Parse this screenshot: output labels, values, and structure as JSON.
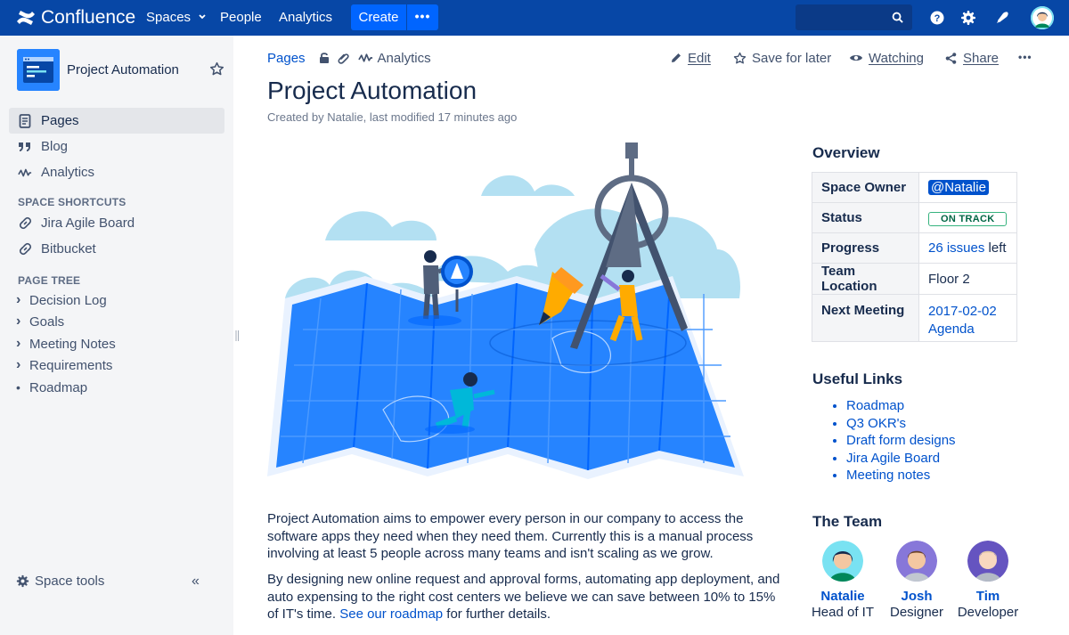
{
  "topnav": {
    "logo_text": "Confluence",
    "spaces_label": "Spaces",
    "people_label": "People",
    "analytics_label": "Analytics",
    "create_label": "Create",
    "more_label": "•••",
    "search_placeholder": "",
    "icons": [
      "search-icon",
      "help-icon",
      "settings-icon",
      "notifications-icon",
      "user-avatar"
    ]
  },
  "sidebar": {
    "space_name": "Project Automation",
    "nav": [
      {
        "label": "Pages",
        "icon": "pages-icon",
        "active": true
      },
      {
        "label": "Blog",
        "icon": "quote-icon"
      },
      {
        "label": "Analytics",
        "icon": "analytics-icon"
      }
    ],
    "shortcuts_heading": "SPACE SHORTCUTS",
    "shortcuts": [
      {
        "label": "Jira Agile Board",
        "icon": "link-icon"
      },
      {
        "label": "Bitbucket",
        "icon": "link-icon"
      }
    ],
    "tree_heading": "PAGE TREE",
    "tree": [
      {
        "label": "Decision Log",
        "marker": "›"
      },
      {
        "label": "Goals",
        "marker": "›"
      },
      {
        "label": "Meeting Notes",
        "marker": "›"
      },
      {
        "label": "Requirements",
        "marker": "›"
      },
      {
        "label": "Roadmap",
        "marker": "•"
      }
    ],
    "space_tools_label": "Space tools",
    "collapse_label": "«"
  },
  "breadcrumbs": {
    "pages": "Pages",
    "analytics": "Analytics"
  },
  "actions": {
    "edit": "Edit",
    "save_for_later": "Save for later",
    "watching": "Watching",
    "share": "Share",
    "more": "•••"
  },
  "page": {
    "title": "Project Automation",
    "byline": "Created by Natalie, last modified 17 minutes ago",
    "para1": "Project Automation aims to empower every person in our company to access the software apps they need when they need them. Currently this is a manual process involving at least 5 people across many teams and isn't scaling as we grow.",
    "para2_text": "By designing new online request and approval forms, automating app deployment, and auto expensing to the right cost centers we believe we can save between 10% to 15% of IT's time.",
    "para2_link": "See our roadmap",
    "para2_tail": "for further details."
  },
  "overview": {
    "heading": "Overview",
    "rows": {
      "owner_key": "Space Owner",
      "owner_val": "@Natalie",
      "status_key": "Status",
      "status_val": "ON TRACK",
      "progress_key": "Progress",
      "progress_link": "26 issues",
      "progress_tail": "left",
      "location_key": "Team Location",
      "location_val": "Floor 2",
      "meeting_key": "Next Meeting",
      "meeting_date": "2017-02-02",
      "meeting_agenda": "Agenda"
    }
  },
  "useful_links": {
    "heading": "Useful Links",
    "items": [
      "Roadmap",
      "Q3 OKR's",
      "Draft form designs",
      "Jira Agile Board",
      "Meeting notes"
    ]
  },
  "team": {
    "heading": "The Team",
    "members": [
      {
        "name": "Natalie",
        "role": "Head of IT"
      },
      {
        "name": "Josh",
        "role": "Designer"
      },
      {
        "name": "Tim",
        "role": "Developer"
      }
    ]
  },
  "colors": {
    "nav_bg": "#0747A6",
    "create_bg": "#0065FF",
    "link": "#0052CC",
    "status_green": "#36B37E"
  }
}
